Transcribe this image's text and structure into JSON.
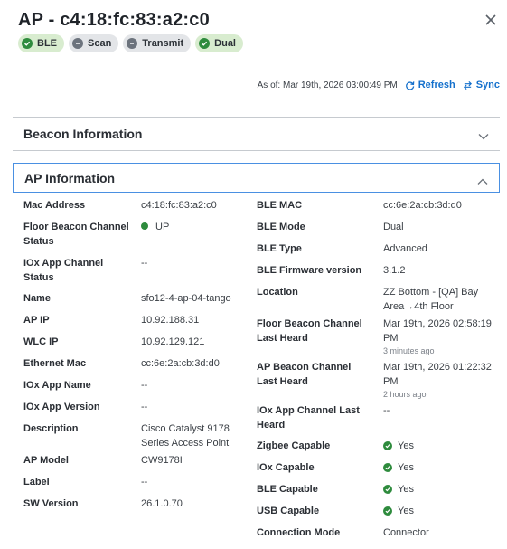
{
  "header": {
    "title": "AP - c4:18:fc:83:a2:c0",
    "badges": [
      {
        "label": "BLE",
        "state": "on"
      },
      {
        "label": "Scan",
        "state": "off"
      },
      {
        "label": "Transmit",
        "state": "off"
      },
      {
        "label": "Dual",
        "state": "on"
      }
    ]
  },
  "toolbar": {
    "as_of": "As of: Mar 19th, 2026 03:00:49 PM",
    "refresh_label": "Refresh",
    "sync_label": "Sync"
  },
  "sections": {
    "beacon": {
      "label": "Beacon Information",
      "expanded": false
    },
    "ap": {
      "label": "AP Information",
      "expanded": true
    }
  },
  "left": [
    {
      "key": "Mac Address",
      "value": "c4:18:fc:83:a2:c0"
    },
    {
      "key": "Floor Beacon Channel Status",
      "value": "UP"
    },
    {
      "key": "IOx App Channel Status",
      "value": "--"
    },
    {
      "key": "Name",
      "value": "sfo12-4-ap-04-tango"
    },
    {
      "key": "AP IP",
      "value": "10.92.188.31"
    },
    {
      "key": "WLC IP",
      "value": "10.92.129.121"
    },
    {
      "key": "Ethernet Mac",
      "value": "cc:6e:2a:cb:3d:d0"
    },
    {
      "key": "IOx App Name",
      "value": "--"
    },
    {
      "key": "IOx App Version",
      "value": "--"
    },
    {
      "key": "Description",
      "value": "Cisco Catalyst 9178 Series Access Point"
    },
    {
      "key": "AP Model",
      "value": "CW9178I"
    },
    {
      "key": "Label",
      "value": "--"
    },
    {
      "key": "SW Version",
      "value": "26.1.0.70"
    }
  ],
  "right": [
    {
      "key": "BLE MAC",
      "value": "cc:6e:2a:cb:3d:d0"
    },
    {
      "key": "BLE Mode",
      "value": "Dual"
    },
    {
      "key": "BLE Type",
      "value": "Advanced"
    },
    {
      "key": "BLE Firmware version",
      "value": "3.1.2"
    },
    {
      "key": "Location",
      "value": "ZZ Bottom - [QA] Bay Area→4th Floor"
    },
    {
      "key": "Floor Beacon Channel Last Heard",
      "value": "Mar 19th, 2026 02:58:19 PM",
      "ago": "3 minutes ago"
    },
    {
      "key": "AP Beacon Channel Last Heard",
      "value": "Mar 19th, 2026 01:22:32 PM",
      "ago": "2 hours ago"
    },
    {
      "key": "IOx App Channel Last Heard",
      "value": "--"
    },
    {
      "key": "Zigbee Capable",
      "value": "Yes"
    },
    {
      "key": "IOx Capable",
      "value": "Yes"
    },
    {
      "key": "BLE Capable",
      "value": "Yes"
    },
    {
      "key": "USB Capable",
      "value": "Yes"
    },
    {
      "key": "Connection Mode",
      "value": "Connector"
    }
  ],
  "colors": {
    "accent": "#1470cc",
    "ok": "#2e8b3d",
    "focus": "#4a90e2"
  }
}
